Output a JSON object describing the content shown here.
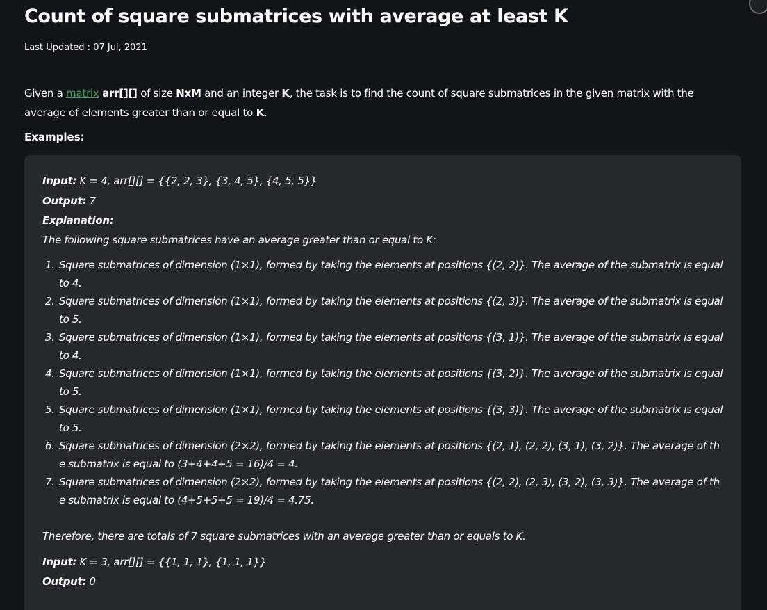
{
  "article": {
    "title": "Count of square submatrices with average at least K",
    "last_updated": "Last Updated : 07 Jul, 2021",
    "intro": {
      "t1": "Given a ",
      "link": "matrix",
      "t2": " ",
      "b1": "arr[][]",
      "t3": " of size ",
      "b2": "NxM",
      "t4": " and an integer ",
      "b3": "K",
      "t5": ", the task is to find the count of square submatrices in the given matrix with the average of elements greater than or equal to ",
      "b4": "K",
      "t6": "."
    },
    "examples_heading": "Examples:"
  },
  "example1": {
    "input_label": "Input:",
    "input_value": " K = 4, arr[][] = {{2, 2, 3}, {3, 4, 5}, {4, 5, 5}}",
    "output_label": "Output:",
    "output_value": " 7",
    "explanation_label": "Explanation:",
    "explanation_intro": "The following square submatrices have an average greater than or equal to K:",
    "items": [
      "Square submatrices of dimension (1×1), formed by taking the elements at positions {(2, 2)}. The average of the submatrix is equal to 4.",
      "Square submatrices of dimension (1×1), formed by taking the elements at positions {(2, 3)}. The average of the submatrix is equal to 5.",
      "Square submatrices of dimension (1×1), formed by taking the elements at positions {(3, 1)}. The average of the submatrix is equal to 4.",
      "Square submatrices of dimension (1×1), formed by taking the elements at positions {(3, 2)}. The average of the submatrix is equal to 5.",
      "Square submatrices of dimension (1×1), formed by taking the elements at positions {(3, 3)}. The average of the submatrix is equal to 5.",
      "Square submatrices of dimension (2×2), formed by taking the elements at positions {(2, 1), (2, 2), (3, 1), (3, 2)}. The average of the submatrix is equal to (3+4+4+5 = 16)/4 = 4.",
      "Square submatrices of dimension (2×2), formed by taking the elements at positions {(2, 2), (2, 3), (3, 2), (3, 3)}. The average of the submatrix is equal to (4+5+5+5 = 19)/4 = 4.75."
    ],
    "conclusion": "Therefore, there are totals of 7 square submatrices with an average greater than or equals to K."
  },
  "example2": {
    "input_label": "Input:",
    "input_value": " K = 3, arr[][] = {{1, 1, 1}, {1, 1, 1}}",
    "output_label": "Output:",
    "output_value": " 0"
  },
  "colors": {
    "background": "#131417",
    "example_box": "#27282b",
    "link": "#3fa35a",
    "text": "#ffffff"
  }
}
